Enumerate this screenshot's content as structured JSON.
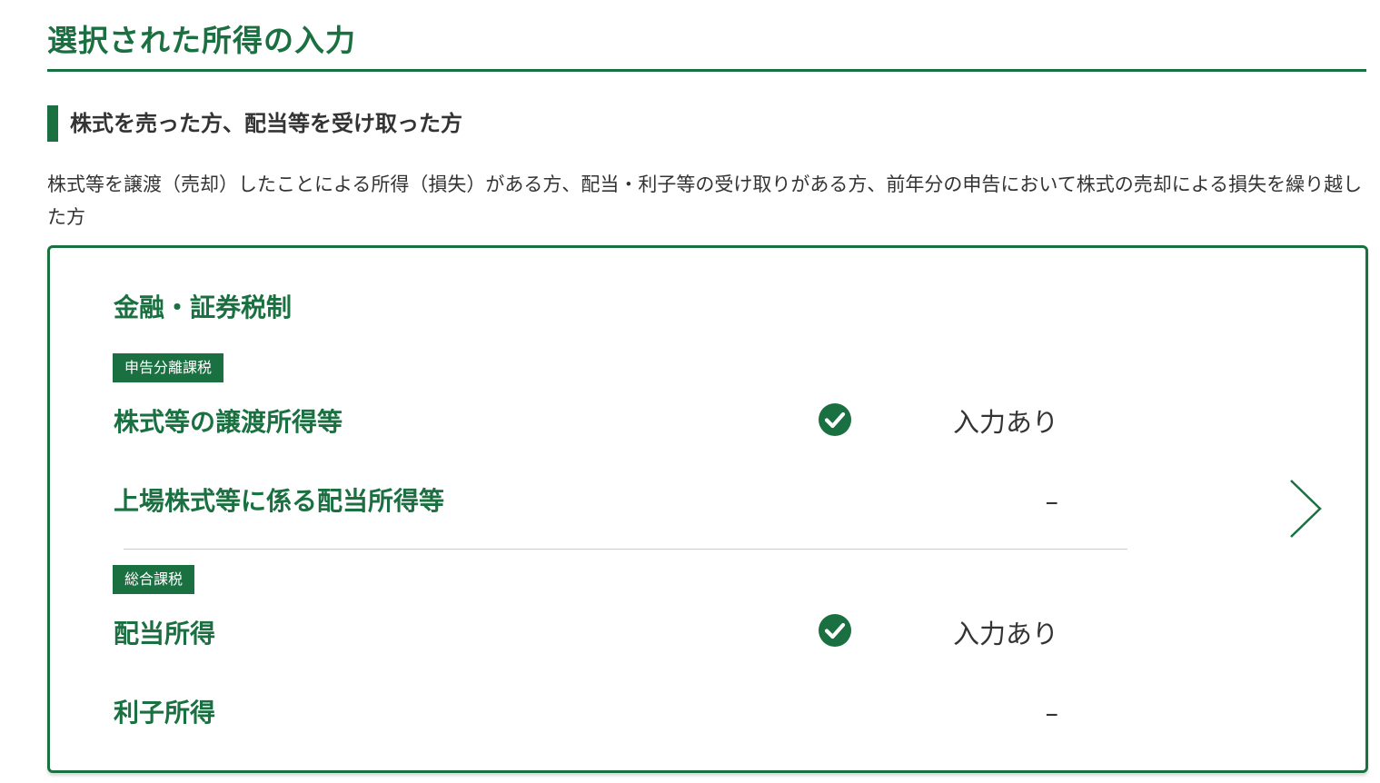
{
  "page": {
    "title": "選択された所得の入力"
  },
  "section": {
    "heading": "株式を売った方、配当等を受け取った方",
    "description": "株式等を譲渡（売却）したことによる所得（損失）がある方、配当・利子等の受け取りがある方、前年分の申告において株式の売却による損失を繰り越した方"
  },
  "card": {
    "title": "金融・証券税制",
    "groups": [
      {
        "badge": "申告分離課税",
        "rows": [
          {
            "label": "株式等の譲渡所得等",
            "status": "入力あり",
            "checked": true
          },
          {
            "label": "上場株式等に係る配当所得等",
            "status": "–",
            "checked": false
          }
        ]
      },
      {
        "badge": "総合課税",
        "rows": [
          {
            "label": "配当所得",
            "status": "入力あり",
            "checked": true
          },
          {
            "label": "利子所得",
            "status": "–",
            "checked": false
          }
        ]
      }
    ],
    "icons": {
      "check": "check-circle-icon",
      "navigate": "chevron-right-icon"
    }
  },
  "colors": {
    "accent": "#1a7040",
    "text": "#333333",
    "divider": "#cccccc"
  }
}
